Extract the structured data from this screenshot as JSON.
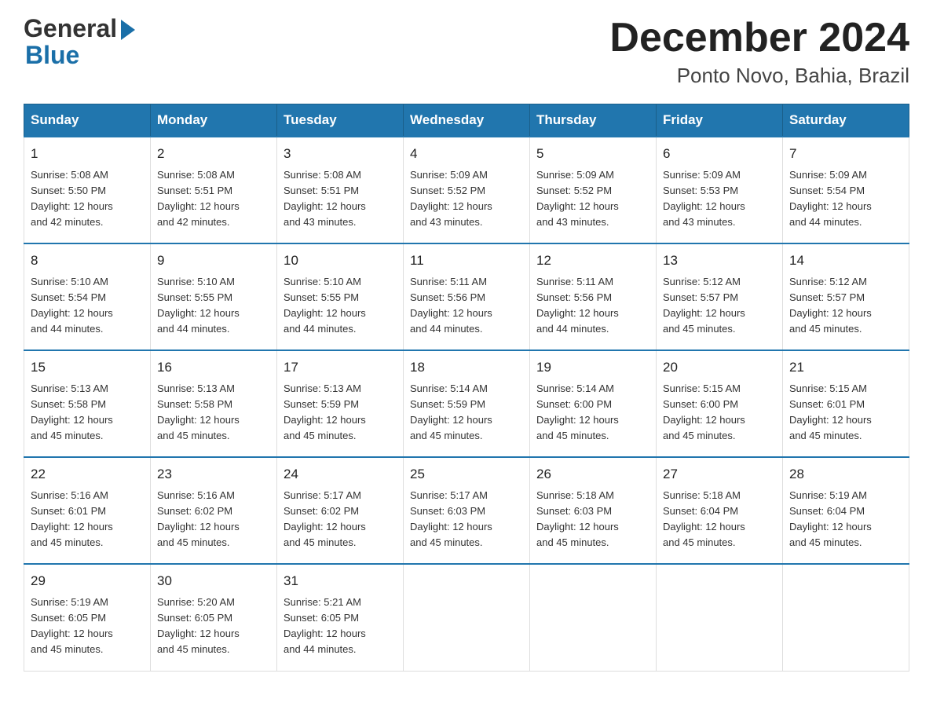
{
  "logo": {
    "general": "General",
    "blue": "Blue",
    "arrow": "▶"
  },
  "header": {
    "title": "December 2024",
    "subtitle": "Ponto Novo, Bahia, Brazil"
  },
  "days_of_week": [
    "Sunday",
    "Monday",
    "Tuesday",
    "Wednesday",
    "Thursday",
    "Friday",
    "Saturday"
  ],
  "weeks": [
    [
      {
        "day": "1",
        "sunrise": "5:08 AM",
        "sunset": "5:50 PM",
        "daylight": "12 hours and 42 minutes."
      },
      {
        "day": "2",
        "sunrise": "5:08 AM",
        "sunset": "5:51 PM",
        "daylight": "12 hours and 42 minutes."
      },
      {
        "day": "3",
        "sunrise": "5:08 AM",
        "sunset": "5:51 PM",
        "daylight": "12 hours and 43 minutes."
      },
      {
        "day": "4",
        "sunrise": "5:09 AM",
        "sunset": "5:52 PM",
        "daylight": "12 hours and 43 minutes."
      },
      {
        "day": "5",
        "sunrise": "5:09 AM",
        "sunset": "5:52 PM",
        "daylight": "12 hours and 43 minutes."
      },
      {
        "day": "6",
        "sunrise": "5:09 AM",
        "sunset": "5:53 PM",
        "daylight": "12 hours and 43 minutes."
      },
      {
        "day": "7",
        "sunrise": "5:09 AM",
        "sunset": "5:54 PM",
        "daylight": "12 hours and 44 minutes."
      }
    ],
    [
      {
        "day": "8",
        "sunrise": "5:10 AM",
        "sunset": "5:54 PM",
        "daylight": "12 hours and 44 minutes."
      },
      {
        "day": "9",
        "sunrise": "5:10 AM",
        "sunset": "5:55 PM",
        "daylight": "12 hours and 44 minutes."
      },
      {
        "day": "10",
        "sunrise": "5:10 AM",
        "sunset": "5:55 PM",
        "daylight": "12 hours and 44 minutes."
      },
      {
        "day": "11",
        "sunrise": "5:11 AM",
        "sunset": "5:56 PM",
        "daylight": "12 hours and 44 minutes."
      },
      {
        "day": "12",
        "sunrise": "5:11 AM",
        "sunset": "5:56 PM",
        "daylight": "12 hours and 44 minutes."
      },
      {
        "day": "13",
        "sunrise": "5:12 AM",
        "sunset": "5:57 PM",
        "daylight": "12 hours and 45 minutes."
      },
      {
        "day": "14",
        "sunrise": "5:12 AM",
        "sunset": "5:57 PM",
        "daylight": "12 hours and 45 minutes."
      }
    ],
    [
      {
        "day": "15",
        "sunrise": "5:13 AM",
        "sunset": "5:58 PM",
        "daylight": "12 hours and 45 minutes."
      },
      {
        "day": "16",
        "sunrise": "5:13 AM",
        "sunset": "5:58 PM",
        "daylight": "12 hours and 45 minutes."
      },
      {
        "day": "17",
        "sunrise": "5:13 AM",
        "sunset": "5:59 PM",
        "daylight": "12 hours and 45 minutes."
      },
      {
        "day": "18",
        "sunrise": "5:14 AM",
        "sunset": "5:59 PM",
        "daylight": "12 hours and 45 minutes."
      },
      {
        "day": "19",
        "sunrise": "5:14 AM",
        "sunset": "6:00 PM",
        "daylight": "12 hours and 45 minutes."
      },
      {
        "day": "20",
        "sunrise": "5:15 AM",
        "sunset": "6:00 PM",
        "daylight": "12 hours and 45 minutes."
      },
      {
        "day": "21",
        "sunrise": "5:15 AM",
        "sunset": "6:01 PM",
        "daylight": "12 hours and 45 minutes."
      }
    ],
    [
      {
        "day": "22",
        "sunrise": "5:16 AM",
        "sunset": "6:01 PM",
        "daylight": "12 hours and 45 minutes."
      },
      {
        "day": "23",
        "sunrise": "5:16 AM",
        "sunset": "6:02 PM",
        "daylight": "12 hours and 45 minutes."
      },
      {
        "day": "24",
        "sunrise": "5:17 AM",
        "sunset": "6:02 PM",
        "daylight": "12 hours and 45 minutes."
      },
      {
        "day": "25",
        "sunrise": "5:17 AM",
        "sunset": "6:03 PM",
        "daylight": "12 hours and 45 minutes."
      },
      {
        "day": "26",
        "sunrise": "5:18 AM",
        "sunset": "6:03 PM",
        "daylight": "12 hours and 45 minutes."
      },
      {
        "day": "27",
        "sunrise": "5:18 AM",
        "sunset": "6:04 PM",
        "daylight": "12 hours and 45 minutes."
      },
      {
        "day": "28",
        "sunrise": "5:19 AM",
        "sunset": "6:04 PM",
        "daylight": "12 hours and 45 minutes."
      }
    ],
    [
      {
        "day": "29",
        "sunrise": "5:19 AM",
        "sunset": "6:05 PM",
        "daylight": "12 hours and 45 minutes."
      },
      {
        "day": "30",
        "sunrise": "5:20 AM",
        "sunset": "6:05 PM",
        "daylight": "12 hours and 45 minutes."
      },
      {
        "day": "31",
        "sunrise": "5:21 AM",
        "sunset": "6:05 PM",
        "daylight": "12 hours and 44 minutes."
      },
      null,
      null,
      null,
      null
    ]
  ]
}
